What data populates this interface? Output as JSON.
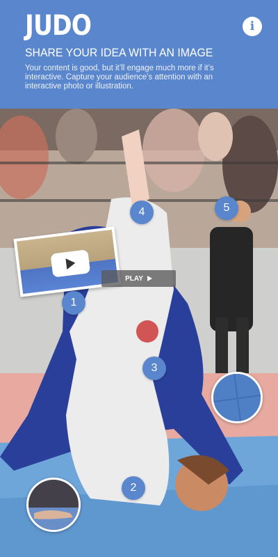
{
  "header": {
    "title": "JUDO",
    "subtitle": "SHARE YOUR IDEA WITH AN IMAGE",
    "description": "Your content is good, but it’ll engage much more if it’s interactive. Capture your audience’s attention with an interactive photo or illustration.",
    "info_glyph": "i",
    "background_color": "#5a86cd"
  },
  "hotspots": [
    {
      "label": "1"
    },
    {
      "label": "2"
    },
    {
      "label": "3"
    },
    {
      "label": "4"
    },
    {
      "label": "5"
    }
  ],
  "play_button": {
    "label": "PLAY"
  },
  "video_thumbnail": {
    "icon": "youtube-play-icon"
  },
  "accent_color": "#5a86cd"
}
